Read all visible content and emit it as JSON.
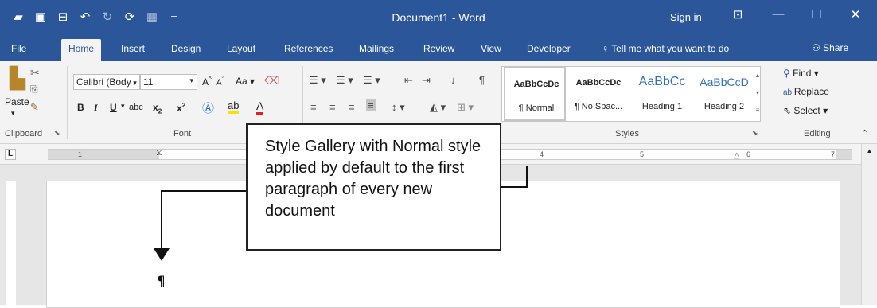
{
  "colors": {
    "accent": "#2b579a",
    "ribbon": "#f3f3f3",
    "workspace": "#e6e6e6"
  },
  "title_bar": {
    "document_title": "Document1 - Word",
    "sign_in": "Sign in",
    "qat_icons": [
      "folder-icon",
      "save-icon",
      "save-as-icon",
      "undo-icon",
      "redo-icon",
      "repeat-icon",
      "touch-mode-icon",
      "customize-icon"
    ]
  },
  "tabs": [
    "File",
    "Home",
    "Insert",
    "Design",
    "Layout",
    "References",
    "Mailings",
    "Review",
    "View",
    "Developer"
  ],
  "tell_me": "Tell me what you want to do",
  "share": "Share",
  "clipboard": {
    "paste": "Paste",
    "label": "Clipboard"
  },
  "font": {
    "name": "Calibri (Body",
    "size": "11",
    "grow": "A",
    "shrink": "A",
    "case": "Aa",
    "bold": "B",
    "italic": "I",
    "underline": "U",
    "strike": "abc",
    "subscript": "x",
    "superscript": "x",
    "label": "Font"
  },
  "styles": {
    "items": [
      {
        "preview": "AaBbCcDc",
        "name": "¶ Normal"
      },
      {
        "preview": "AaBbCcDc",
        "name": "¶ No Spac..."
      },
      {
        "preview": "AaBbCc",
        "name": "Heading 1"
      },
      {
        "preview": "AaBbCcD",
        "name": "Heading 2"
      }
    ],
    "label": "Styles"
  },
  "editing": {
    "find": "Find",
    "replace": "Replace",
    "select": "Select",
    "label": "Editing"
  },
  "ruler_numbers": [
    "1",
    "4",
    "5",
    "6",
    "7"
  ],
  "callout": "Style Gallery with Normal style applied by default to the first paragraph of every new document",
  "cursor": "¶"
}
